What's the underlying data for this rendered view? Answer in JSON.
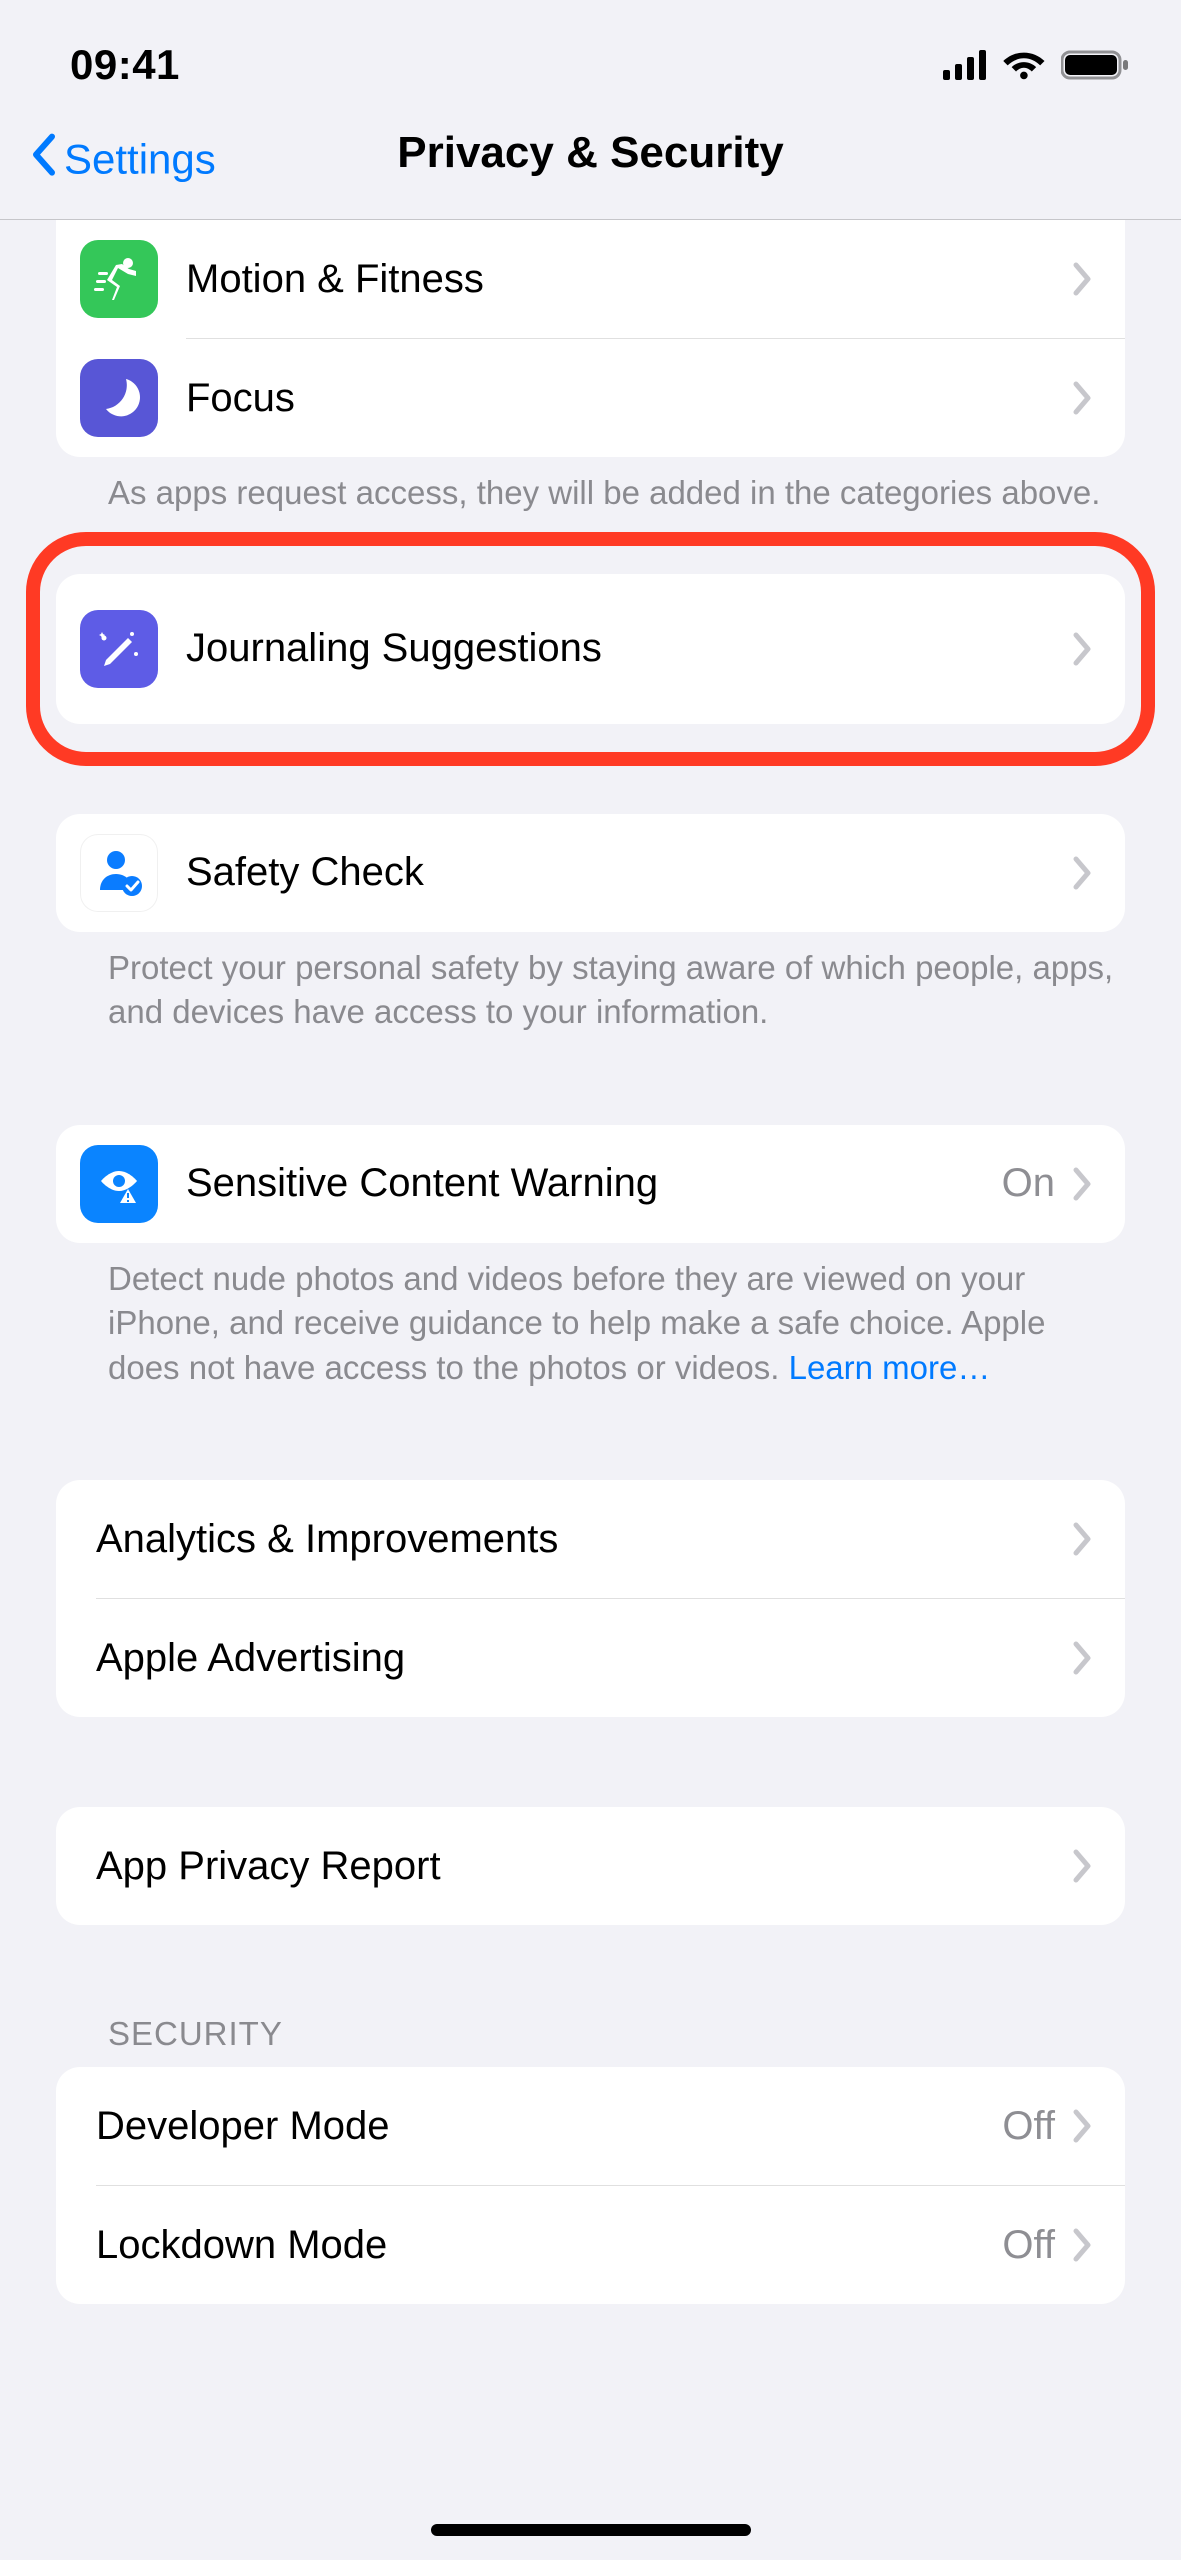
{
  "status": {
    "time": "09:41"
  },
  "nav": {
    "back_label": "Settings",
    "title": "Privacy & Security"
  },
  "group1": {
    "items": [
      {
        "label": "Motion & Fitness"
      },
      {
        "label": "Focus"
      }
    ],
    "footer": "As apps request access, they will be added in the categories above."
  },
  "group2": {
    "items": [
      {
        "label": "Journaling Suggestions"
      }
    ]
  },
  "group3": {
    "items": [
      {
        "label": "Safety Check"
      }
    ],
    "footer": "Protect your personal safety by staying aware of which people, apps, and devices have access to your information."
  },
  "group4": {
    "items": [
      {
        "label": "Sensitive Content Warning",
        "value": "On"
      }
    ],
    "footer_text": "Detect nude photos and videos before they are viewed on your iPhone, and receive guidance to help make a safe choice. Apple does not have access to the photos or videos. ",
    "footer_link": "Learn more…"
  },
  "group5": {
    "items": [
      {
        "label": "Analytics & Improvements"
      },
      {
        "label": "Apple Advertising"
      }
    ]
  },
  "group6": {
    "items": [
      {
        "label": "App Privacy Report"
      }
    ]
  },
  "group7": {
    "header": "Security",
    "items": [
      {
        "label": "Developer Mode",
        "value": "Off"
      },
      {
        "label": "Lockdown Mode",
        "value": "Off"
      }
    ]
  }
}
